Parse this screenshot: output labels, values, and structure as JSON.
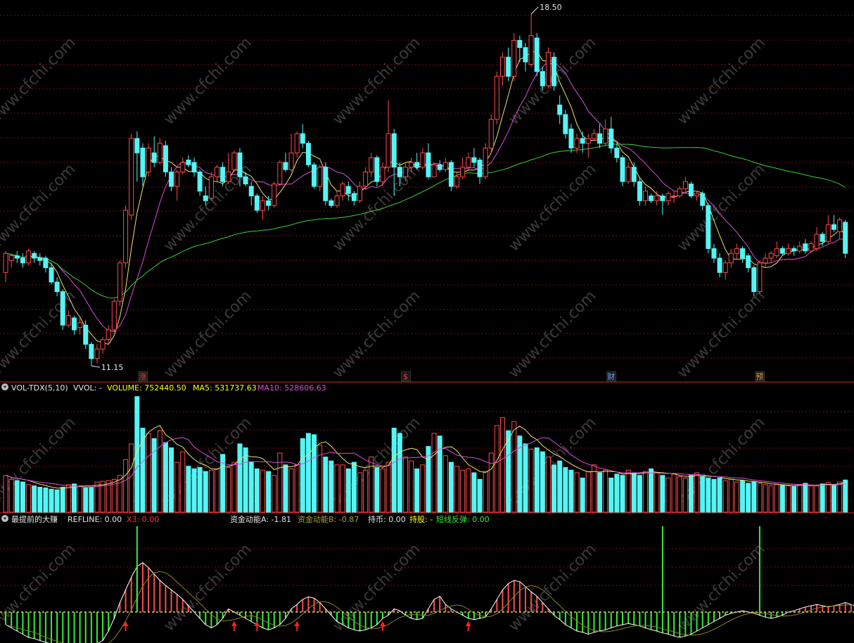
{
  "colors": {
    "background": "#000000",
    "grid": "#7a1010",
    "panel_border": "#9a1414",
    "up": "#ff4b4b",
    "down": "#54f5f5",
    "ma_yellow": "#e9e46c",
    "ma_magenta": "#d84fd8",
    "ma_green": "#37d137",
    "text_white": "#e6e6e6",
    "label_yellow": "#ffff00",
    "label_red": "#ff3030",
    "label_olive": "#a8a23c",
    "label_green": "#33ee33",
    "watermark": "#3a3a3a"
  },
  "watermark": "www.cfchi.com",
  "price_panel": {
    "high_label": "18.50",
    "low_label": "11.15",
    "markers": [
      {
        "text": "涨",
        "color": "#e04040"
      },
      {
        "text": "$",
        "color": "#e04040"
      },
      {
        "text": "财",
        "color": "#6aa8ff"
      },
      {
        "text": "预",
        "color": "#e0a040"
      }
    ]
  },
  "volume_panel": {
    "title": "VOL-TDX(5,10)",
    "vvol": "VVOL: -",
    "volume": "VOLUME: 752440.50",
    "ma5": "MA5: 531737.63",
    "ma10": "MA10: 528606.63"
  },
  "indicator_panel": {
    "title": "最提前的大赚",
    "refline": "REFLINE: 0.00",
    "x3": "X3: 0.00",
    "fund_a": "资金动能A: -1.81",
    "fund_b": "资金动能B: -0.87",
    "hold_coin": "持币: 0.00",
    "hold_stock": "持股: -",
    "short_rebound": "短线反弹: 0.00"
  },
  "chart_data": [
    {
      "type": "candlestick",
      "title": "",
      "price_high": 18.5,
      "price_low": 11.15,
      "candles": [
        [
          13.1,
          13.5,
          13.55,
          12.9
        ],
        [
          13.35,
          13.45,
          13.5,
          13.2
        ],
        [
          13.45,
          13.4,
          13.55,
          13.3
        ],
        [
          13.4,
          13.3,
          13.5,
          13.2
        ],
        [
          13.3,
          13.55,
          13.6,
          13.25
        ],
        [
          13.5,
          13.4,
          13.55,
          13.3
        ],
        [
          13.4,
          13.35,
          13.5,
          13.25
        ],
        [
          13.4,
          13.2,
          13.45,
          13.1
        ],
        [
          13.2,
          12.9,
          13.3,
          12.85
        ],
        [
          12.9,
          12.7,
          13.0,
          12.6
        ],
        [
          12.7,
          12.0,
          12.75,
          11.9
        ],
        [
          12.0,
          12.2,
          12.3,
          11.95
        ],
        [
          12.15,
          11.9,
          12.2,
          11.8
        ],
        [
          11.95,
          12.05,
          12.15,
          11.8
        ],
        [
          12.0,
          11.6,
          12.1,
          11.5
        ],
        [
          11.6,
          11.3,
          11.65,
          11.15
        ],
        [
          11.3,
          11.5,
          11.6,
          11.2
        ],
        [
          11.5,
          11.7,
          11.75,
          11.4
        ],
        [
          11.7,
          11.9,
          12.0,
          11.6
        ],
        [
          11.9,
          12.5,
          12.55,
          11.85
        ],
        [
          12.5,
          13.3,
          13.35,
          12.4
        ],
        [
          13.3,
          14.4,
          14.5,
          13.2
        ],
        [
          14.3,
          15.9,
          16.0,
          14.2
        ],
        [
          15.9,
          15.6,
          16.05,
          15.0
        ],
        [
          15.7,
          15.1,
          15.8,
          14.9
        ],
        [
          15.2,
          15.7,
          15.8,
          15.1
        ],
        [
          15.6,
          15.4,
          15.95,
          15.3
        ],
        [
          15.4,
          15.8,
          15.9,
          15.35
        ],
        [
          15.75,
          15.2,
          15.85,
          15.1
        ],
        [
          15.2,
          14.9,
          15.3,
          14.8
        ],
        [
          14.9,
          15.2,
          15.25,
          14.6
        ],
        [
          15.2,
          15.4,
          15.5,
          15.15
        ],
        [
          15.45,
          15.35,
          15.55,
          15.3
        ],
        [
          15.4,
          15.2,
          15.5,
          15.1
        ],
        [
          15.2,
          14.8,
          15.25,
          14.7
        ],
        [
          14.7,
          14.6,
          14.9,
          14.5
        ],
        [
          14.65,
          15.1,
          15.2,
          14.6
        ],
        [
          15.1,
          15.3,
          15.35,
          15.0
        ],
        [
          15.3,
          15.0,
          15.4,
          14.9
        ],
        [
          15.0,
          15.2,
          15.6,
          14.95
        ],
        [
          15.25,
          15.6,
          15.65,
          15.2
        ],
        [
          15.6,
          15.1,
          15.7,
          14.9
        ],
        [
          15.1,
          14.95,
          15.2,
          14.9
        ],
        [
          14.9,
          14.7,
          15.0,
          14.5
        ],
        [
          14.7,
          14.4,
          14.75,
          14.35
        ],
        [
          14.4,
          14.6,
          14.7,
          14.2
        ],
        [
          14.6,
          14.5,
          14.7,
          14.4
        ],
        [
          14.5,
          14.95,
          15.0,
          14.45
        ],
        [
          14.95,
          15.4,
          15.45,
          14.9
        ],
        [
          15.4,
          15.25,
          15.6,
          15.2
        ],
        [
          15.25,
          15.6,
          16.0,
          15.2
        ],
        [
          15.6,
          16.0,
          16.05,
          15.5
        ],
        [
          16.0,
          15.8,
          16.2,
          15.7
        ],
        [
          15.8,
          15.35,
          15.85,
          15.3
        ],
        [
          15.35,
          14.9,
          15.4,
          14.85
        ],
        [
          14.9,
          15.3,
          15.35,
          14.8
        ],
        [
          15.3,
          14.6,
          15.4,
          14.5
        ],
        [
          14.6,
          14.5,
          14.65,
          14.45
        ],
        [
          14.5,
          14.7,
          14.8,
          14.45
        ],
        [
          14.7,
          14.95,
          15.0,
          14.6
        ],
        [
          14.9,
          14.75,
          15.0,
          14.6
        ],
        [
          14.75,
          14.6,
          14.8,
          14.5
        ],
        [
          14.6,
          14.9,
          15.0,
          14.55
        ],
        [
          14.9,
          15.2,
          15.3,
          14.85
        ],
        [
          15.2,
          15.5,
          15.6,
          15.1
        ],
        [
          15.5,
          15.0,
          15.55,
          14.9
        ],
        [
          15.0,
          15.3,
          15.4,
          14.9
        ],
        [
          15.3,
          16.0,
          16.7,
          15.2
        ],
        [
          16.0,
          15.3,
          16.1,
          14.7
        ],
        [
          15.3,
          15.1,
          15.4,
          14.9
        ],
        [
          15.1,
          15.3,
          15.4,
          15.0
        ],
        [
          15.3,
          15.4,
          15.5,
          15.2
        ],
        [
          15.4,
          15.3,
          15.6,
          15.25
        ],
        [
          15.3,
          15.6,
          15.7,
          15.25
        ],
        [
          15.6,
          15.1,
          15.8,
          15.05
        ],
        [
          15.1,
          15.35,
          15.4,
          15.1
        ],
        [
          15.35,
          15.25,
          15.45,
          15.2
        ],
        [
          15.25,
          15.4,
          15.5,
          15.2
        ],
        [
          15.4,
          14.9,
          15.45,
          14.8
        ],
        [
          14.9,
          15.1,
          15.2,
          14.85
        ],
        [
          15.1,
          15.3,
          15.5,
          15.05
        ],
        [
          15.3,
          15.5,
          15.6,
          15.25
        ],
        [
          15.5,
          15.4,
          15.7,
          15.3
        ],
        [
          15.45,
          15.1,
          15.5,
          14.95
        ],
        [
          15.1,
          15.7,
          15.8,
          15.05
        ],
        [
          15.7,
          16.3,
          16.4,
          15.6
        ],
        [
          16.3,
          17.2,
          17.3,
          16.2
        ],
        [
          17.2,
          17.6,
          17.7,
          17.0
        ],
        [
          17.6,
          17.2,
          17.8,
          17.1
        ],
        [
          17.2,
          17.95,
          18.1,
          17.1
        ],
        [
          17.95,
          17.8,
          18.05,
          17.5
        ],
        [
          17.8,
          17.5,
          17.9,
          17.3
        ],
        [
          17.45,
          18.05,
          18.5,
          17.4
        ],
        [
          18.0,
          17.3,
          18.1,
          17.2
        ],
        [
          17.3,
          17.0,
          17.4,
          16.9
        ],
        [
          17.0,
          17.7,
          17.8,
          16.95
        ],
        [
          17.6,
          17.0,
          17.7,
          16.9
        ],
        [
          16.6,
          16.4,
          16.8,
          16.2
        ],
        [
          16.4,
          16.0,
          16.5,
          15.9
        ],
        [
          16.1,
          15.7,
          16.2,
          15.6
        ],
        [
          15.7,
          15.9,
          16.0,
          15.6
        ],
        [
          15.9,
          15.8,
          16.05,
          15.6
        ],
        [
          15.8,
          15.9,
          16.0,
          15.5
        ],
        [
          15.9,
          16.0,
          16.1,
          15.85
        ],
        [
          16.0,
          15.8,
          16.2,
          15.7
        ],
        [
          15.8,
          16.1,
          16.3,
          15.75
        ],
        [
          16.1,
          15.7,
          16.35,
          15.6
        ],
        [
          15.7,
          15.5,
          15.8,
          15.4
        ],
        [
          15.5,
          15.0,
          15.55,
          14.9
        ],
        [
          15.0,
          15.3,
          15.4,
          14.95
        ],
        [
          15.3,
          15.0,
          15.4,
          14.9
        ],
        [
          15.0,
          14.6,
          15.1,
          14.5
        ],
        [
          14.6,
          14.8,
          14.9,
          14.5
        ],
        [
          14.7,
          14.6,
          14.75,
          14.55
        ],
        [
          14.6,
          14.7,
          14.8,
          14.5
        ],
        [
          14.7,
          14.6,
          14.75,
          14.3
        ],
        [
          14.6,
          14.75,
          14.8,
          14.5
        ],
        [
          14.7,
          14.7,
          14.8,
          14.55
        ],
        [
          14.7,
          14.85,
          14.9,
          14.65
        ],
        [
          14.85,
          15.0,
          15.1,
          14.8
        ],
        [
          14.95,
          14.7,
          15.0,
          14.65
        ],
        [
          14.7,
          14.75,
          14.8,
          14.6
        ],
        [
          14.75,
          14.5,
          14.8,
          14.4
        ],
        [
          14.5,
          13.6,
          14.55,
          13.5
        ],
        [
          13.6,
          13.4,
          13.7,
          13.3
        ],
        [
          13.4,
          13.1,
          13.5,
          13.0
        ],
        [
          13.1,
          13.3,
          13.35,
          12.95
        ],
        [
          13.3,
          13.5,
          13.6,
          13.2
        ],
        [
          13.5,
          13.6,
          13.7,
          13.4
        ],
        [
          13.6,
          13.4,
          13.65,
          13.3
        ],
        [
          13.45,
          13.2,
          13.5,
          13.1
        ],
        [
          13.2,
          12.7,
          13.25,
          12.6
        ],
        [
          12.7,
          13.3,
          13.35,
          12.65
        ],
        [
          13.3,
          13.4,
          13.5,
          13.2
        ],
        [
          13.4,
          13.5,
          13.55,
          13.3
        ],
        [
          13.45,
          13.6,
          13.75,
          13.4
        ],
        [
          13.6,
          13.5,
          13.65,
          13.45
        ],
        [
          13.5,
          13.6,
          13.7,
          13.45
        ],
        [
          13.6,
          13.55,
          13.65,
          13.45
        ],
        [
          13.55,
          13.65,
          13.75,
          13.5
        ],
        [
          13.7,
          13.55,
          13.8,
          13.5
        ],
        [
          13.55,
          13.7,
          13.75,
          13.5
        ],
        [
          13.6,
          13.9,
          14.05,
          13.55
        ],
        [
          13.9,
          13.75,
          13.95,
          13.65
        ],
        [
          13.75,
          14.1,
          14.3,
          13.7
        ],
        [
          14.1,
          14.0,
          14.3,
          13.95
        ],
        [
          13.95,
          14.2,
          14.25,
          13.8
        ],
        [
          14.15,
          13.5,
          14.2,
          13.4
        ]
      ],
      "ma_periods": [
        5,
        10,
        60
      ]
    },
    {
      "type": "bar",
      "title": "VOL-TDX(5,10)",
      "ylim": [
        0,
        900000
      ],
      "values": [
        280000,
        250000,
        240000,
        230000,
        210000,
        200000,
        190000,
        185000,
        175000,
        170000,
        190000,
        210000,
        215000,
        200000,
        185000,
        190000,
        230000,
        235000,
        240000,
        250000,
        280000,
        400000,
        520000,
        880000,
        640000,
        600000,
        560000,
        620000,
        530000,
        490000,
        380000,
        460000,
        350000,
        330000,
        340000,
        310000,
        320000,
        330000,
        440000,
        340000,
        380000,
        520000,
        490000,
        380000,
        330000,
        320000,
        310000,
        280000,
        450000,
        360000,
        330000,
        360000,
        560000,
        600000,
        590000,
        510000,
        420000,
        390000,
        360000,
        360000,
        330000,
        380000,
        300000,
        320000,
        420000,
        340000,
        330000,
        380000,
        640000,
        600000,
        420000,
        390000,
        330000,
        360000,
        500000,
        600000,
        580000,
        430000,
        380000,
        350000,
        320000,
        330000,
        300000,
        250000,
        310000,
        450000,
        660000,
        720000,
        620000,
        690000,
        580000,
        520000,
        480000,
        490000,
        460000,
        420000,
        360000,
        390000,
        340000,
        320000,
        300000,
        260000,
        310000,
        360000,
        300000,
        320000,
        260000,
        290000,
        280000,
        320000,
        300000,
        280000,
        310000,
        330000,
        300000,
        280000,
        260000,
        290000,
        270000,
        260000,
        280000,
        300000,
        270000,
        260000,
        250000,
        260000,
        240000,
        250000,
        230000,
        240000,
        220000,
        230000,
        220000,
        210000,
        200000,
        210000,
        205000,
        200000,
        195000,
        210000,
        220000,
        200000,
        200000,
        215000,
        225000,
        210000,
        230000,
        245000
      ]
    },
    {
      "type": "area",
      "title": "最提前的大赚",
      "ylim": [
        -1,
        1
      ],
      "values": [
        -0.2,
        -0.25,
        -0.3,
        -0.35,
        -0.4,
        -0.42,
        -0.45,
        -0.48,
        -0.5,
        -0.52,
        -0.55,
        -0.6,
        -0.62,
        -0.6,
        -0.58,
        -0.55,
        -0.5,
        -0.45,
        -0.3,
        -0.1,
        0.15,
        0.35,
        0.55,
        0.72,
        0.78,
        0.7,
        0.6,
        0.5,
        0.42,
        0.35,
        0.28,
        0.2,
        0.1,
        0.0,
        -0.1,
        -0.2,
        -0.25,
        -0.2,
        -0.1,
        0.05,
        0.0,
        -0.05,
        -0.1,
        -0.15,
        -0.2,
        -0.25,
        -0.28,
        -0.25,
        -0.2,
        -0.1,
        0.05,
        0.12,
        0.2,
        0.24,
        0.22,
        0.15,
        0.05,
        -0.05,
        -0.15,
        -0.2,
        -0.25,
        -0.28,
        -0.3,
        -0.28,
        -0.25,
        -0.2,
        -0.1,
        -0.05,
        0.05,
        0.02,
        -0.05,
        -0.1,
        -0.12,
        -0.1,
        0.05,
        0.2,
        0.25,
        0.12,
        0.05,
        0.0,
        -0.05,
        -0.1,
        -0.12,
        -0.1,
        -0.08,
        0.05,
        0.2,
        0.35,
        0.45,
        0.5,
        0.48,
        0.4,
        0.32,
        0.25,
        0.15,
        0.05,
        -0.05,
        -0.12,
        -0.2,
        -0.25,
        -0.3,
        -0.32,
        -0.35,
        -0.32,
        -0.3,
        -0.28,
        -0.25,
        -0.22,
        -0.2,
        -0.18,
        -0.2,
        -0.22,
        -0.25,
        -0.28,
        -0.3,
        -0.33,
        -0.35,
        -0.38,
        -0.4,
        -0.38,
        -0.35,
        -0.3,
        -0.25,
        -0.2,
        -0.15,
        -0.1,
        -0.05,
        -0.02,
        0.0,
        0.02,
        0.0,
        -0.02,
        -0.05,
        -0.08,
        -0.1,
        -0.08,
        -0.05,
        0.0,
        0.02,
        0.05,
        0.08,
        0.1,
        0.12,
        0.1,
        0.08,
        0.1,
        0.12,
        0.15,
        0.12,
        0.08
      ],
      "signal_lines": [
        23,
        115,
        132
      ],
      "arrows": [
        21,
        40,
        44,
        51,
        66,
        81
      ]
    }
  ]
}
